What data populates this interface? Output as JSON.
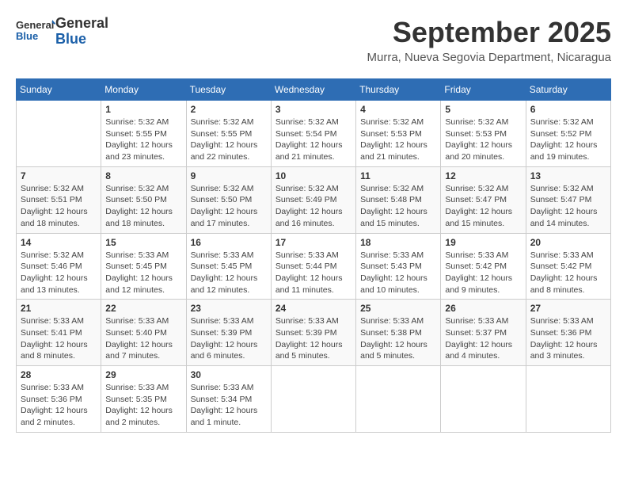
{
  "header": {
    "logo_line1": "General",
    "logo_line2": "Blue",
    "month_title": "September 2025",
    "location": "Murra, Nueva Segovia Department, Nicaragua"
  },
  "days_of_week": [
    "Sunday",
    "Monday",
    "Tuesday",
    "Wednesday",
    "Thursday",
    "Friday",
    "Saturday"
  ],
  "weeks": [
    [
      {
        "day": "",
        "content": ""
      },
      {
        "day": "1",
        "content": "Sunrise: 5:32 AM\nSunset: 5:55 PM\nDaylight: 12 hours\nand 23 minutes."
      },
      {
        "day": "2",
        "content": "Sunrise: 5:32 AM\nSunset: 5:55 PM\nDaylight: 12 hours\nand 22 minutes."
      },
      {
        "day": "3",
        "content": "Sunrise: 5:32 AM\nSunset: 5:54 PM\nDaylight: 12 hours\nand 21 minutes."
      },
      {
        "day": "4",
        "content": "Sunrise: 5:32 AM\nSunset: 5:53 PM\nDaylight: 12 hours\nand 21 minutes."
      },
      {
        "day": "5",
        "content": "Sunrise: 5:32 AM\nSunset: 5:53 PM\nDaylight: 12 hours\nand 20 minutes."
      },
      {
        "day": "6",
        "content": "Sunrise: 5:32 AM\nSunset: 5:52 PM\nDaylight: 12 hours\nand 19 minutes."
      }
    ],
    [
      {
        "day": "7",
        "content": "Sunrise: 5:32 AM\nSunset: 5:51 PM\nDaylight: 12 hours\nand 18 minutes."
      },
      {
        "day": "8",
        "content": "Sunrise: 5:32 AM\nSunset: 5:50 PM\nDaylight: 12 hours\nand 18 minutes."
      },
      {
        "day": "9",
        "content": "Sunrise: 5:32 AM\nSunset: 5:50 PM\nDaylight: 12 hours\nand 17 minutes."
      },
      {
        "day": "10",
        "content": "Sunrise: 5:32 AM\nSunset: 5:49 PM\nDaylight: 12 hours\nand 16 minutes."
      },
      {
        "day": "11",
        "content": "Sunrise: 5:32 AM\nSunset: 5:48 PM\nDaylight: 12 hours\nand 15 minutes."
      },
      {
        "day": "12",
        "content": "Sunrise: 5:32 AM\nSunset: 5:47 PM\nDaylight: 12 hours\nand 15 minutes."
      },
      {
        "day": "13",
        "content": "Sunrise: 5:32 AM\nSunset: 5:47 PM\nDaylight: 12 hours\nand 14 minutes."
      }
    ],
    [
      {
        "day": "14",
        "content": "Sunrise: 5:32 AM\nSunset: 5:46 PM\nDaylight: 12 hours\nand 13 minutes."
      },
      {
        "day": "15",
        "content": "Sunrise: 5:33 AM\nSunset: 5:45 PM\nDaylight: 12 hours\nand 12 minutes."
      },
      {
        "day": "16",
        "content": "Sunrise: 5:33 AM\nSunset: 5:45 PM\nDaylight: 12 hours\nand 12 minutes."
      },
      {
        "day": "17",
        "content": "Sunrise: 5:33 AM\nSunset: 5:44 PM\nDaylight: 12 hours\nand 11 minutes."
      },
      {
        "day": "18",
        "content": "Sunrise: 5:33 AM\nSunset: 5:43 PM\nDaylight: 12 hours\nand 10 minutes."
      },
      {
        "day": "19",
        "content": "Sunrise: 5:33 AM\nSunset: 5:42 PM\nDaylight: 12 hours\nand 9 minutes."
      },
      {
        "day": "20",
        "content": "Sunrise: 5:33 AM\nSunset: 5:42 PM\nDaylight: 12 hours\nand 8 minutes."
      }
    ],
    [
      {
        "day": "21",
        "content": "Sunrise: 5:33 AM\nSunset: 5:41 PM\nDaylight: 12 hours\nand 8 minutes."
      },
      {
        "day": "22",
        "content": "Sunrise: 5:33 AM\nSunset: 5:40 PM\nDaylight: 12 hours\nand 7 minutes."
      },
      {
        "day": "23",
        "content": "Sunrise: 5:33 AM\nSunset: 5:39 PM\nDaylight: 12 hours\nand 6 minutes."
      },
      {
        "day": "24",
        "content": "Sunrise: 5:33 AM\nSunset: 5:39 PM\nDaylight: 12 hours\nand 5 minutes."
      },
      {
        "day": "25",
        "content": "Sunrise: 5:33 AM\nSunset: 5:38 PM\nDaylight: 12 hours\nand 5 minutes."
      },
      {
        "day": "26",
        "content": "Sunrise: 5:33 AM\nSunset: 5:37 PM\nDaylight: 12 hours\nand 4 minutes."
      },
      {
        "day": "27",
        "content": "Sunrise: 5:33 AM\nSunset: 5:36 PM\nDaylight: 12 hours\nand 3 minutes."
      }
    ],
    [
      {
        "day": "28",
        "content": "Sunrise: 5:33 AM\nSunset: 5:36 PM\nDaylight: 12 hours\nand 2 minutes."
      },
      {
        "day": "29",
        "content": "Sunrise: 5:33 AM\nSunset: 5:35 PM\nDaylight: 12 hours\nand 2 minutes."
      },
      {
        "day": "30",
        "content": "Sunrise: 5:33 AM\nSunset: 5:34 PM\nDaylight: 12 hours\nand 1 minute."
      },
      {
        "day": "",
        "content": ""
      },
      {
        "day": "",
        "content": ""
      },
      {
        "day": "",
        "content": ""
      },
      {
        "day": "",
        "content": ""
      }
    ]
  ]
}
